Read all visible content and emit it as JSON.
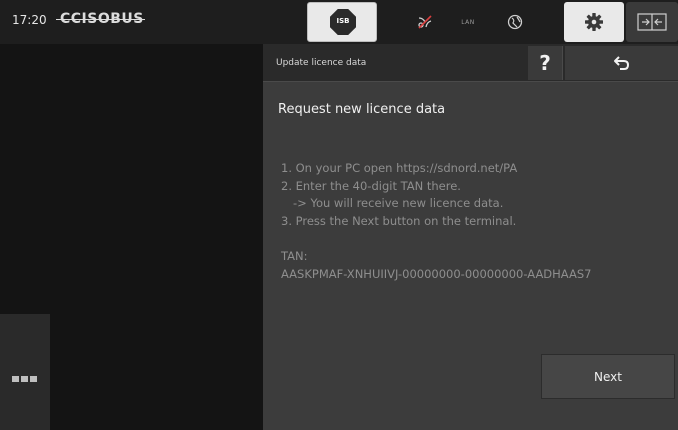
{
  "status_bar": {
    "time": "17:20",
    "brand": "CCISOBUS",
    "isb_label": "ISB",
    "lan_label": "LAN"
  },
  "dialog": {
    "title": "Update licence data",
    "help_label": "?",
    "heading": "Request new licence data",
    "steps": [
      "1. On your PC open https://sdnord.net/PA",
      "2. Enter the 40-digit TAN there.",
      "-> You will receive new licence data.",
      "3. Press the Next button on the terminal."
    ],
    "tan_label": "TAN:",
    "tan_value": "AASKPMAF-XNHUIIVJ-00000000-00000000-AADHAAS7",
    "next_label": "Next"
  },
  "icons": [
    "isb-stop-icon",
    "no-gps-icon",
    "lan-icon",
    "globe-icon",
    "gear-icon",
    "swap-screens-icon",
    "back-arrow-icon",
    "menu-dots-icon"
  ],
  "colors": {
    "accent_light": "#e9e9e9",
    "panel": "#3c3c3c",
    "background": "#141414",
    "muted_text": "#8e8e8e"
  }
}
